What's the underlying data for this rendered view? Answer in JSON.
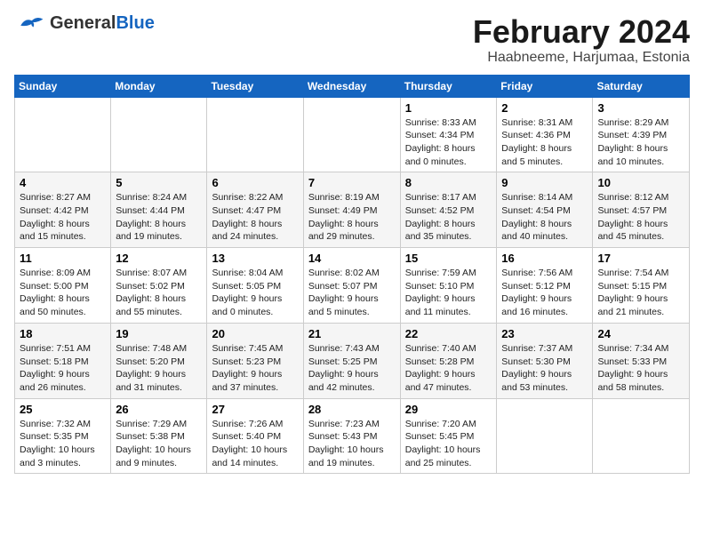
{
  "logo": {
    "line1": "General",
    "line2": "Blue"
  },
  "title": "February 2024",
  "subtitle": "Haabneeme, Harjumaa, Estonia",
  "headers": [
    "Sunday",
    "Monday",
    "Tuesday",
    "Wednesday",
    "Thursday",
    "Friday",
    "Saturday"
  ],
  "weeks": [
    [
      {
        "day": "",
        "info": ""
      },
      {
        "day": "",
        "info": ""
      },
      {
        "day": "",
        "info": ""
      },
      {
        "day": "",
        "info": ""
      },
      {
        "day": "1",
        "info": "Sunrise: 8:33 AM\nSunset: 4:34 PM\nDaylight: 8 hours\nand 0 minutes."
      },
      {
        "day": "2",
        "info": "Sunrise: 8:31 AM\nSunset: 4:36 PM\nDaylight: 8 hours\nand 5 minutes."
      },
      {
        "day": "3",
        "info": "Sunrise: 8:29 AM\nSunset: 4:39 PM\nDaylight: 8 hours\nand 10 minutes."
      }
    ],
    [
      {
        "day": "4",
        "info": "Sunrise: 8:27 AM\nSunset: 4:42 PM\nDaylight: 8 hours\nand 15 minutes."
      },
      {
        "day": "5",
        "info": "Sunrise: 8:24 AM\nSunset: 4:44 PM\nDaylight: 8 hours\nand 19 minutes."
      },
      {
        "day": "6",
        "info": "Sunrise: 8:22 AM\nSunset: 4:47 PM\nDaylight: 8 hours\nand 24 minutes."
      },
      {
        "day": "7",
        "info": "Sunrise: 8:19 AM\nSunset: 4:49 PM\nDaylight: 8 hours\nand 29 minutes."
      },
      {
        "day": "8",
        "info": "Sunrise: 8:17 AM\nSunset: 4:52 PM\nDaylight: 8 hours\nand 35 minutes."
      },
      {
        "day": "9",
        "info": "Sunrise: 8:14 AM\nSunset: 4:54 PM\nDaylight: 8 hours\nand 40 minutes."
      },
      {
        "day": "10",
        "info": "Sunrise: 8:12 AM\nSunset: 4:57 PM\nDaylight: 8 hours\nand 45 minutes."
      }
    ],
    [
      {
        "day": "11",
        "info": "Sunrise: 8:09 AM\nSunset: 5:00 PM\nDaylight: 8 hours\nand 50 minutes."
      },
      {
        "day": "12",
        "info": "Sunrise: 8:07 AM\nSunset: 5:02 PM\nDaylight: 8 hours\nand 55 minutes."
      },
      {
        "day": "13",
        "info": "Sunrise: 8:04 AM\nSunset: 5:05 PM\nDaylight: 9 hours\nand 0 minutes."
      },
      {
        "day": "14",
        "info": "Sunrise: 8:02 AM\nSunset: 5:07 PM\nDaylight: 9 hours\nand 5 minutes."
      },
      {
        "day": "15",
        "info": "Sunrise: 7:59 AM\nSunset: 5:10 PM\nDaylight: 9 hours\nand 11 minutes."
      },
      {
        "day": "16",
        "info": "Sunrise: 7:56 AM\nSunset: 5:12 PM\nDaylight: 9 hours\nand 16 minutes."
      },
      {
        "day": "17",
        "info": "Sunrise: 7:54 AM\nSunset: 5:15 PM\nDaylight: 9 hours\nand 21 minutes."
      }
    ],
    [
      {
        "day": "18",
        "info": "Sunrise: 7:51 AM\nSunset: 5:18 PM\nDaylight: 9 hours\nand 26 minutes."
      },
      {
        "day": "19",
        "info": "Sunrise: 7:48 AM\nSunset: 5:20 PM\nDaylight: 9 hours\nand 31 minutes."
      },
      {
        "day": "20",
        "info": "Sunrise: 7:45 AM\nSunset: 5:23 PM\nDaylight: 9 hours\nand 37 minutes."
      },
      {
        "day": "21",
        "info": "Sunrise: 7:43 AM\nSunset: 5:25 PM\nDaylight: 9 hours\nand 42 minutes."
      },
      {
        "day": "22",
        "info": "Sunrise: 7:40 AM\nSunset: 5:28 PM\nDaylight: 9 hours\nand 47 minutes."
      },
      {
        "day": "23",
        "info": "Sunrise: 7:37 AM\nSunset: 5:30 PM\nDaylight: 9 hours\nand 53 minutes."
      },
      {
        "day": "24",
        "info": "Sunrise: 7:34 AM\nSunset: 5:33 PM\nDaylight: 9 hours\nand 58 minutes."
      }
    ],
    [
      {
        "day": "25",
        "info": "Sunrise: 7:32 AM\nSunset: 5:35 PM\nDaylight: 10 hours\nand 3 minutes."
      },
      {
        "day": "26",
        "info": "Sunrise: 7:29 AM\nSunset: 5:38 PM\nDaylight: 10 hours\nand 9 minutes."
      },
      {
        "day": "27",
        "info": "Sunrise: 7:26 AM\nSunset: 5:40 PM\nDaylight: 10 hours\nand 14 minutes."
      },
      {
        "day": "28",
        "info": "Sunrise: 7:23 AM\nSunset: 5:43 PM\nDaylight: 10 hours\nand 19 minutes."
      },
      {
        "day": "29",
        "info": "Sunrise: 7:20 AM\nSunset: 5:45 PM\nDaylight: 10 hours\nand 25 minutes."
      },
      {
        "day": "",
        "info": ""
      },
      {
        "day": "",
        "info": ""
      }
    ]
  ]
}
